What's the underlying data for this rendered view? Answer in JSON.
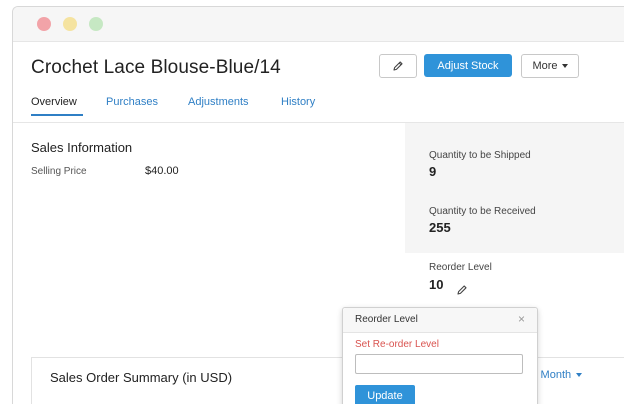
{
  "header": {
    "item_title": "Crochet Lace Blouse-Blue/14",
    "edit_icon": "pencil-icon",
    "adjust_stock_label": "Adjust Stock",
    "more_label": "More"
  },
  "tabs": [
    {
      "label": "Overview",
      "active": true
    },
    {
      "label": "Purchases",
      "active": false
    },
    {
      "label": "Adjustments",
      "active": false
    },
    {
      "label": "History",
      "active": false
    }
  ],
  "sales_info": {
    "title": "Sales Information",
    "selling_price_label": "Selling Price",
    "selling_price_value": "$40.00"
  },
  "stats": {
    "to_be_shipped_label": "Quantity to be Shipped",
    "to_be_shipped_value": "9",
    "to_be_received_label": "Quantity to be Received",
    "to_be_received_value": "255",
    "reorder_level_label": "Reorder Level",
    "reorder_level_value": "10"
  },
  "popover": {
    "title": "Reorder Level",
    "close_glyph": "×",
    "field_label": "Set Re-order Level",
    "input_value": "",
    "update_label": "Update"
  },
  "summary": {
    "title": "Sales Order Summary (in USD)",
    "filter_label": "s Month"
  },
  "colors": {
    "accent": "#2f93d9",
    "link": "#2f7fc5",
    "error": "#d9534f"
  }
}
